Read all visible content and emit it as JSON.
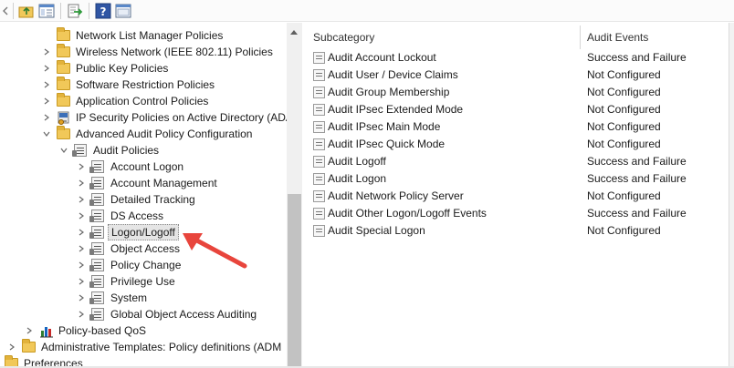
{
  "toolbar": {
    "icons": [
      "back-icon",
      "up-folder-icon",
      "show-hide-tree-icon",
      "export-list-icon",
      "help-icon",
      "properties-icon"
    ]
  },
  "tree": {
    "items": [
      {
        "label": "Network List Manager Policies",
        "icon": "folder-icon",
        "expanded": false,
        "has_children": false
      },
      {
        "label": "Wireless Network (IEEE 802.11) Policies",
        "icon": "folder-icon",
        "expanded": false,
        "has_children": true
      },
      {
        "label": "Public Key Policies",
        "icon": "folder-icon",
        "expanded": false,
        "has_children": true
      },
      {
        "label": "Software Restriction Policies",
        "icon": "folder-icon",
        "expanded": false,
        "has_children": true
      },
      {
        "label": "Application Control Policies",
        "icon": "folder-icon",
        "expanded": false,
        "has_children": true
      },
      {
        "label": "IP Security Policies on Active Directory (ADA",
        "icon": "ip-security-icon",
        "expanded": false,
        "has_children": true
      },
      {
        "label": "Advanced Audit Policy Configuration",
        "icon": "folder-icon",
        "expanded": true,
        "has_children": true
      },
      {
        "label": "Audit Policies",
        "icon": "audit-policy-icon",
        "expanded": true,
        "has_children": true
      },
      {
        "label": "Account Logon",
        "icon": "audit-policy-icon",
        "expanded": false,
        "has_children": true
      },
      {
        "label": "Account Management",
        "icon": "audit-policy-icon",
        "expanded": false,
        "has_children": true
      },
      {
        "label": "Detailed Tracking",
        "icon": "audit-policy-icon",
        "expanded": false,
        "has_children": true
      },
      {
        "label": "DS Access",
        "icon": "audit-policy-icon",
        "expanded": false,
        "has_children": true
      },
      {
        "label": "Logon/Logoff",
        "icon": "audit-policy-icon",
        "expanded": false,
        "has_children": true,
        "selected": true
      },
      {
        "label": "Object Access",
        "icon": "audit-policy-icon",
        "expanded": false,
        "has_children": true
      },
      {
        "label": "Policy Change",
        "icon": "audit-policy-icon",
        "expanded": false,
        "has_children": true
      },
      {
        "label": "Privilege Use",
        "icon": "audit-policy-icon",
        "expanded": false,
        "has_children": true
      },
      {
        "label": "System",
        "icon": "audit-policy-icon",
        "expanded": false,
        "has_children": true
      },
      {
        "label": "Global Object Access Auditing",
        "icon": "audit-policy-icon",
        "expanded": false,
        "has_children": true
      },
      {
        "label": "Policy-based QoS",
        "icon": "bar-chart-icon",
        "expanded": false,
        "has_children": true
      },
      {
        "label": "Administrative Templates: Policy definitions (ADM",
        "icon": "folder-icon",
        "expanded": false,
        "has_children": true
      },
      {
        "label": "Preferences",
        "icon": "folder-icon",
        "expanded": false,
        "has_children": true
      }
    ]
  },
  "list": {
    "columns": {
      "subcategory": "Subcategory",
      "audit_events": "Audit Events"
    },
    "rows": [
      {
        "name": "Audit Account Lockout",
        "value": "Success and Failure"
      },
      {
        "name": "Audit User / Device Claims",
        "value": "Not Configured"
      },
      {
        "name": "Audit Group Membership",
        "value": "Not Configured"
      },
      {
        "name": "Audit IPsec Extended Mode",
        "value": "Not Configured"
      },
      {
        "name": "Audit IPsec Main Mode",
        "value": "Not Configured"
      },
      {
        "name": "Audit IPsec Quick Mode",
        "value": "Not Configured"
      },
      {
        "name": "Audit Logoff",
        "value": "Success and Failure"
      },
      {
        "name": "Audit Logon",
        "value": "Success and Failure"
      },
      {
        "name": "Audit Network Policy Server",
        "value": "Not Configured"
      },
      {
        "name": "Audit Other Logon/Logoff Events",
        "value": "Success and Failure"
      },
      {
        "name": "Audit Special Logon",
        "value": "Not Configured"
      }
    ]
  },
  "colors": {
    "annotation_arrow": "#e8453c",
    "folder": "#f1c859",
    "selection": "#e5e5e5"
  }
}
